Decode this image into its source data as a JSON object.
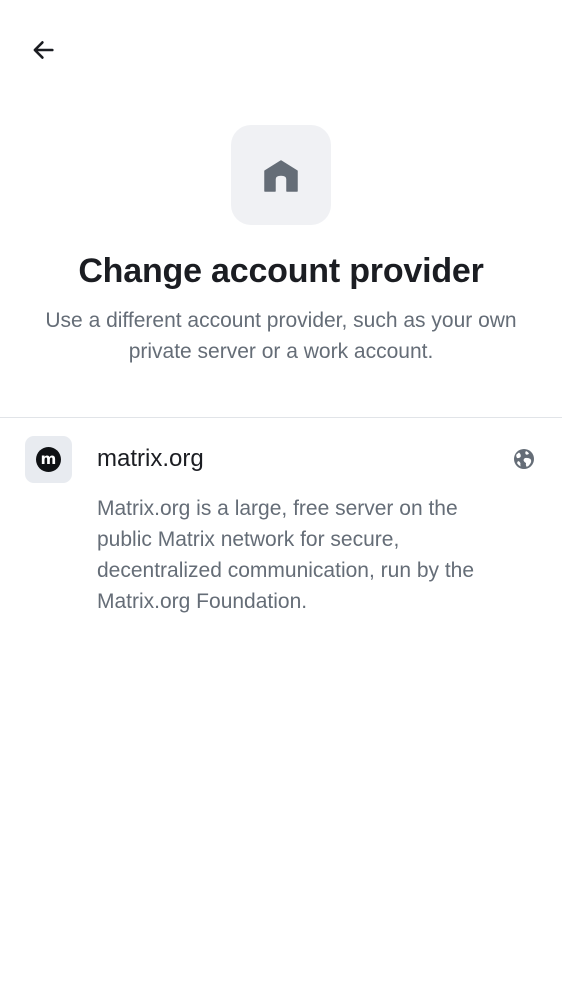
{
  "header": {
    "back_icon": "arrow-left-icon"
  },
  "hero": {
    "icon": "home-icon",
    "title": "Change account provider",
    "subtitle": "Use a different account provider, such as your own private server or a work account."
  },
  "providers": [
    {
      "logo_letter": "m",
      "name": "matrix.org",
      "trailing_icon": "globe-icon",
      "description": "Matrix.org is a large, free server on the public Matrix network for secure, decentralized communication, run by the Matrix.org Foundation."
    }
  ],
  "colors": {
    "text_primary": "#1b1d22",
    "text_secondary": "#656d77",
    "icon_box_bg": "#f0f1f4",
    "icon_fg": "#656d77",
    "divider": "#e1e4e8"
  }
}
